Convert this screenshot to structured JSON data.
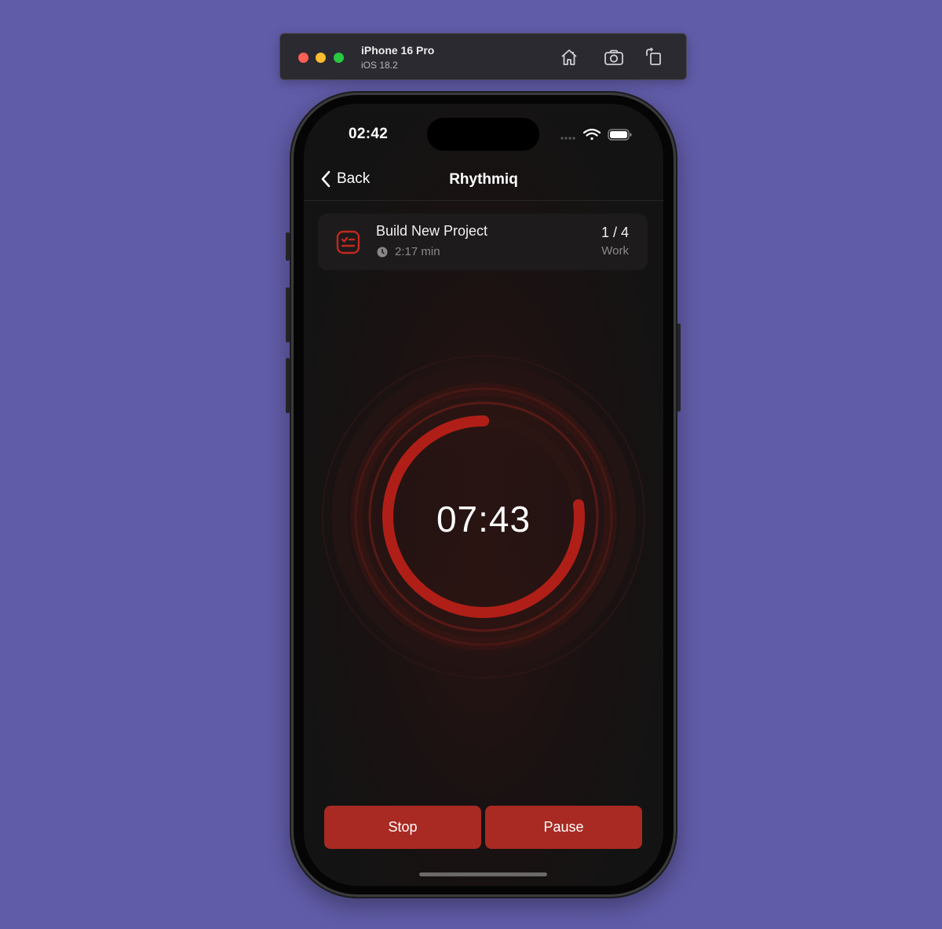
{
  "simulator": {
    "device_name": "iPhone 16 Pro",
    "os_version": "iOS 18.2",
    "icons": [
      "home-icon",
      "screenshot-icon",
      "rotate-icon"
    ]
  },
  "status_bar": {
    "time": "02:42",
    "icons": [
      "cellular-icon",
      "wifi-icon",
      "battery-icon"
    ]
  },
  "nav": {
    "back_label": "Back",
    "title": "Rhythmiq"
  },
  "task": {
    "title": "Build New Project",
    "duration": "2:17 min",
    "progress": "1 / 4",
    "phase": "Work",
    "icon": "checklist-icon"
  },
  "timer": {
    "remaining": "07:43",
    "progress_fraction": 0.77
  },
  "buttons": {
    "stop_label": "Stop",
    "pause_label": "Pause"
  },
  "colors": {
    "accent": "#a92a22",
    "ring": "#b01f17",
    "background": "#615ca8"
  }
}
